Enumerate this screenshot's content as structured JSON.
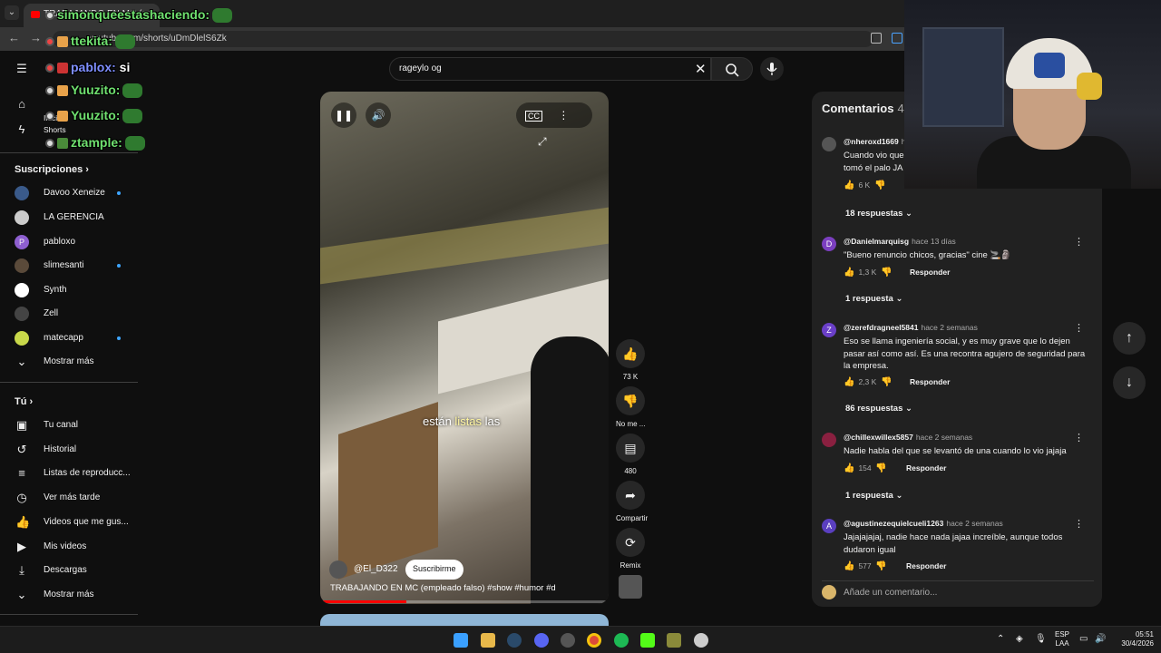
{
  "browser": {
    "tab_title": "TRABAJANDO EN MC (em",
    "url": "youtube.com/shorts/uDmDlelS6Zk"
  },
  "sidebar": {
    "main_items": [
      {
        "label": "Inicio",
        "icon": "home-icon"
      },
      {
        "label": "Shorts",
        "icon": "shorts-icon"
      }
    ],
    "subscriptions_title": "Suscripciones",
    "subscriptions": [
      {
        "label": "Davoo Xeneize",
        "new": true,
        "color": "#3a5a8a"
      },
      {
        "label": "LA GERENCIA",
        "new": false,
        "color": "#cccccc"
      },
      {
        "label": "pabloxo",
        "new": false,
        "color": "#8e5fd0"
      },
      {
        "label": "slimesanti",
        "new": true,
        "color": "#5a4a3a"
      },
      {
        "label": "Synth",
        "new": false,
        "color": "#ffffff"
      },
      {
        "label": "Zell",
        "new": false,
        "color": "#444444"
      },
      {
        "label": "matecapp",
        "new": true,
        "color": "#c8d84a"
      }
    ],
    "show_more_1": "Mostrar más",
    "you_title": "Tú",
    "you_items": [
      {
        "label": "Tu canal",
        "icon": "user-icon"
      },
      {
        "label": "Historial",
        "icon": "history-icon"
      },
      {
        "label": "Listas de reproducc...",
        "icon": "playlist-icon"
      },
      {
        "label": "Ver más tarde",
        "icon": "clock-icon"
      },
      {
        "label": "Videos que me gus...",
        "icon": "thumbs-up-icon"
      },
      {
        "label": "Mis videos",
        "icon": "video-icon"
      },
      {
        "label": "Descargas",
        "icon": "download-icon"
      }
    ],
    "show_more_2": "Mostrar más"
  },
  "search": {
    "value": "rageylo og"
  },
  "video": {
    "caption_before": "están ",
    "caption_highlight": "listas",
    "caption_after": " las",
    "channel": "@El_D322",
    "subscribe_label": "Suscribirme",
    "title": "TRABAJANDO EN MC (empleado falso) #show #humor #d",
    "progress": 0.3
  },
  "actions": {
    "likes": "73 K",
    "dislike_label": "No me ...",
    "comments": "480",
    "share_label": "Compartir",
    "remix_label": "Remix"
  },
  "comments": {
    "title": "Comentarios",
    "count": "48",
    "add_placeholder": "Añade un comentario...",
    "reply_label": "Responder",
    "items": [
      {
        "author": "@nheroxd1669",
        "time": "h",
        "text": "Cuando vio que tomó el palo JA",
        "likes": "6 K",
        "replies": "18 respuestas",
        "avatar_letter": "",
        "avatar_color": "#555555"
      },
      {
        "author": "@Danielmarquisg",
        "time": "hace 13 días",
        "text": "\"Bueno renuncio chicos, gracias\" cine 🚬🗿",
        "likes": "1,3 K",
        "replies": "1 respuesta",
        "avatar_letter": "D",
        "avatar_color": "#7b3fbf"
      },
      {
        "author": "@zerefdragneel5841",
        "time": "hace 2 semanas",
        "text": "Eso se llama ingeniería social, y es muy grave que lo dejen pasar así como así. Es una recontra agujero de seguridad para la empresa.",
        "likes": "2,3 K",
        "replies": "86 respuestas",
        "avatar_letter": "Z",
        "avatar_color": "#6a3fc8"
      },
      {
        "author": "@chillexwillex5857",
        "time": "hace 2 semanas",
        "text": "Nadie habla del que se levantó de una cuando lo vio jajaja",
        "likes": "154",
        "replies": "1 respuesta",
        "avatar_letter": "",
        "avatar_color": "#8a2040"
      },
      {
        "author": "@agustinezequielcueli1263",
        "time": "hace 2 semanas",
        "text": "Jajajajajaj, nadie hace nada jajaa increíble, aunque todos dudaron igual",
        "likes": "577",
        "replies": "",
        "avatar_letter": "A",
        "avatar_color": "#5a3fc0"
      }
    ]
  },
  "chat_overlay": [
    {
      "user": "simonqueestashaciendo:",
      "message": ""
    },
    {
      "user": "ttekita:",
      "message": ""
    },
    {
      "user": "pablox:",
      "message": "si"
    },
    {
      "user": "Yuuzito:",
      "message": ""
    },
    {
      "user": "Yuuzito:",
      "message": ""
    },
    {
      "user": "ztample:",
      "message": ""
    }
  ],
  "taskbar": {
    "language": "ESP",
    "language_sub": "LAA",
    "time": "05:51",
    "date": "30/4/2026"
  }
}
